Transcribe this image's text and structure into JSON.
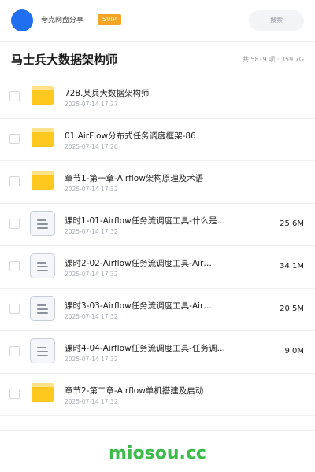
{
  "topbar": {
    "user_name": "夸克网盘分享",
    "badge": "SVIP",
    "search_placeholder": "搜索"
  },
  "header": {
    "title": "马士兵大数据架构师",
    "summary": "共 5819 项 · 359.7G"
  },
  "items": [
    {
      "type": "folder",
      "name": "728.某兵大数据架构师",
      "date": "2025-07-14 17:27",
      "size": ""
    },
    {
      "type": "folder",
      "name": "01.AirFlow分布式任务调度框架-86",
      "date": "2025-07-14 17:26",
      "size": ""
    },
    {
      "type": "folder",
      "name": "章节1-第一章-Airflow架构原理及术语",
      "date": "2025-07-14 17:32",
      "size": ""
    },
    {
      "type": "file",
      "name": "课时1-01-Airflow任务流调度工具-什么是…",
      "date": "2025-07-14 17:32",
      "size": "25.6M"
    },
    {
      "type": "file",
      "name": "课时2-02-Airflow任务流调度工具-Air…",
      "date": "2025-07-14 17:32",
      "size": "34.1M"
    },
    {
      "type": "file",
      "name": "课时3-03-Airflow任务流调度工具-Air…",
      "date": "2025-07-14 17:32",
      "size": "20.5M"
    },
    {
      "type": "file",
      "name": "课时4-04-Airflow任务流调度工具-任务调…",
      "date": "2025-07-14 17:32",
      "size": "9.0M"
    },
    {
      "type": "folder",
      "name": "章节2-第二章-Airflow单机搭建及启动",
      "date": "2025-07-14 17:32",
      "size": ""
    }
  ],
  "watermark": "miosou.cc",
  "colors": {
    "avatar": "#1f6ff0",
    "badge": "#f5a524",
    "folder": "#ffc81e",
    "watermark": "#3cbb4a"
  }
}
